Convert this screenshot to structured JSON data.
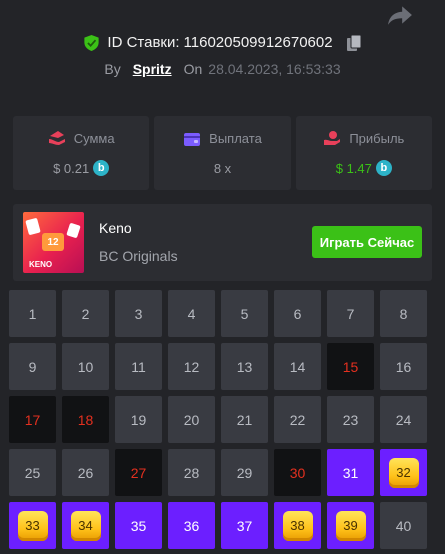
{
  "header": {
    "bet_id_label": "ID Ставки:",
    "bet_id": "116020509912670602",
    "by_label": "By",
    "user": "Spritz",
    "on_label": "On",
    "date": "28.04.2023, 16:53:33"
  },
  "stats": [
    {
      "label": "Сумма",
      "value": "$ 0.21",
      "icon": "amount-icon",
      "color": "#e8405a",
      "coin": "b"
    },
    {
      "label": "Выплата",
      "value": "8 x",
      "icon": "wallet-icon",
      "color": "#7b5cff"
    },
    {
      "label": "Прибыль",
      "value": "$ 1.47",
      "icon": "profit-icon",
      "color": "#e8405a",
      "coin": "b",
      "value_color": "#3bc117"
    }
  ],
  "game": {
    "name": "Keno",
    "provider": "BC Originals",
    "play_label": "Играть Сейчас",
    "thumb_number": "12",
    "thumb_label": "KENO"
  },
  "grid": [
    {
      "n": "1",
      "state": "normal"
    },
    {
      "n": "2",
      "state": "normal"
    },
    {
      "n": "3",
      "state": "normal"
    },
    {
      "n": "4",
      "state": "normal"
    },
    {
      "n": "5",
      "state": "normal"
    },
    {
      "n": "6",
      "state": "normal"
    },
    {
      "n": "7",
      "state": "normal"
    },
    {
      "n": "8",
      "state": "normal"
    },
    {
      "n": "9",
      "state": "normal"
    },
    {
      "n": "10",
      "state": "normal"
    },
    {
      "n": "11",
      "state": "normal"
    },
    {
      "n": "12",
      "state": "normal"
    },
    {
      "n": "13",
      "state": "normal"
    },
    {
      "n": "14",
      "state": "normal"
    },
    {
      "n": "15",
      "state": "miss"
    },
    {
      "n": "16",
      "state": "normal"
    },
    {
      "n": "17",
      "state": "miss"
    },
    {
      "n": "18",
      "state": "miss"
    },
    {
      "n": "19",
      "state": "normal"
    },
    {
      "n": "20",
      "state": "normal"
    },
    {
      "n": "21",
      "state": "normal"
    },
    {
      "n": "22",
      "state": "normal"
    },
    {
      "n": "23",
      "state": "normal"
    },
    {
      "n": "24",
      "state": "normal"
    },
    {
      "n": "25",
      "state": "normal"
    },
    {
      "n": "26",
      "state": "normal"
    },
    {
      "n": "27",
      "state": "miss"
    },
    {
      "n": "28",
      "state": "normal"
    },
    {
      "n": "29",
      "state": "normal"
    },
    {
      "n": "30",
      "state": "miss"
    },
    {
      "n": "31",
      "state": "pick"
    },
    {
      "n": "32",
      "state": "hit"
    },
    {
      "n": "33",
      "state": "hit"
    },
    {
      "n": "34",
      "state": "hit"
    },
    {
      "n": "35",
      "state": "pick"
    },
    {
      "n": "36",
      "state": "pick"
    },
    {
      "n": "37",
      "state": "pick"
    },
    {
      "n": "38",
      "state": "hit"
    },
    {
      "n": "39",
      "state": "hit"
    },
    {
      "n": "40",
      "state": "normal"
    }
  ]
}
